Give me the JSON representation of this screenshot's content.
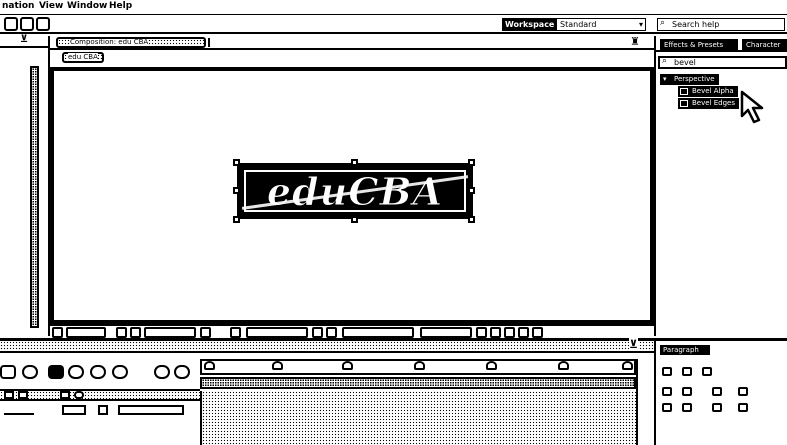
{
  "menubar": {
    "items": [
      "nation",
      "View",
      "Window",
      "Help"
    ]
  },
  "toolbar": {
    "workspace_label": "Workspace",
    "workspace_value": "Standard",
    "help_search_placeholder": "Search help"
  },
  "composition": {
    "tab_label": "Composition: edu CBA",
    "breadcrumb": "edu CBA",
    "logo_text": "eduCBA"
  },
  "effects_panel": {
    "tab_label": "Effects & Presets",
    "tab2_label": "Character",
    "search_value": "bevel",
    "category": "Perspective",
    "items": [
      "Bevel Alpha",
      "Bevel Edges"
    ]
  },
  "paragraph_panel": {
    "tab_label": "Paragraph"
  },
  "colors": {
    "foreground": "#000000",
    "background": "#ffffff"
  },
  "icons": {
    "search": "search-icon",
    "cursor": "arrow-cursor-icon",
    "keyframe": "keyframe-icon"
  }
}
